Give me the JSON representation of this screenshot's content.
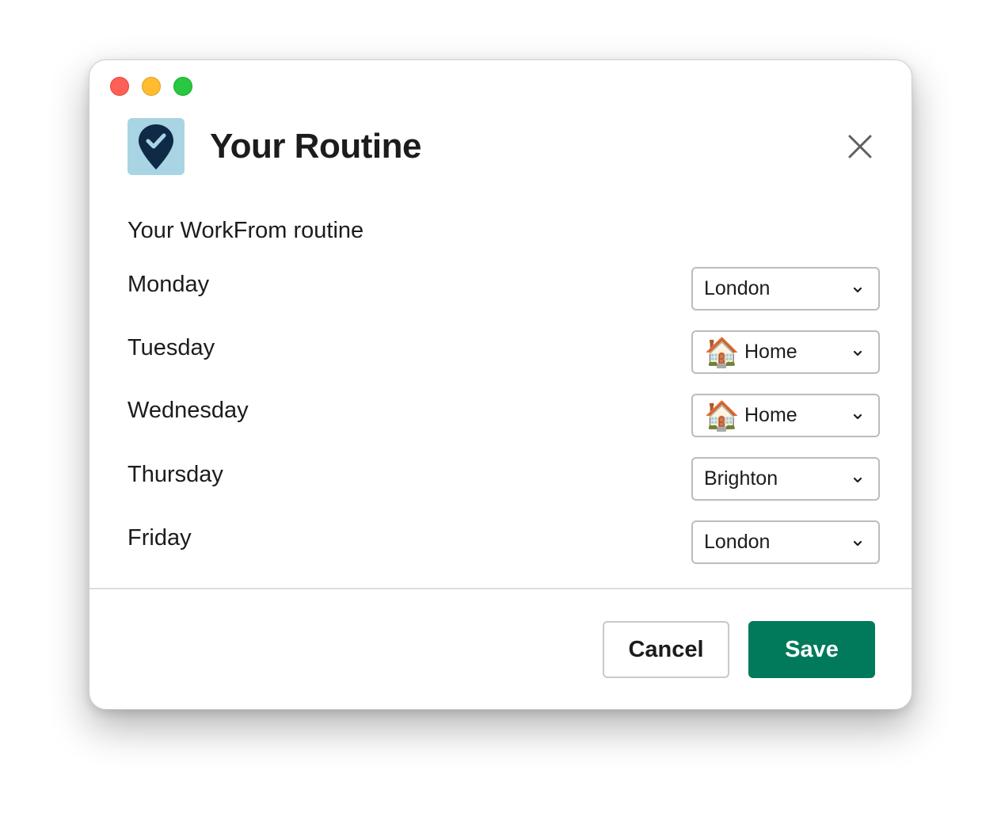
{
  "dialog": {
    "title": "Your Routine",
    "subtitle": "Your WorkFrom routine",
    "app_icon": "location-pin-check-icon",
    "accent_color": "#007a5a",
    "icon_bg_color": "#a9d4e3"
  },
  "routine": [
    {
      "day": "Monday",
      "selected": "London",
      "emoji": ""
    },
    {
      "day": "Tuesday",
      "selected": "Home",
      "emoji": "🏠"
    },
    {
      "day": "Wednesday",
      "selected": "Home",
      "emoji": "🏠"
    },
    {
      "day": "Thursday",
      "selected": "Brighton",
      "emoji": ""
    },
    {
      "day": "Friday",
      "selected": "London",
      "emoji": ""
    }
  ],
  "footer": {
    "cancel_label": "Cancel",
    "save_label": "Save"
  }
}
